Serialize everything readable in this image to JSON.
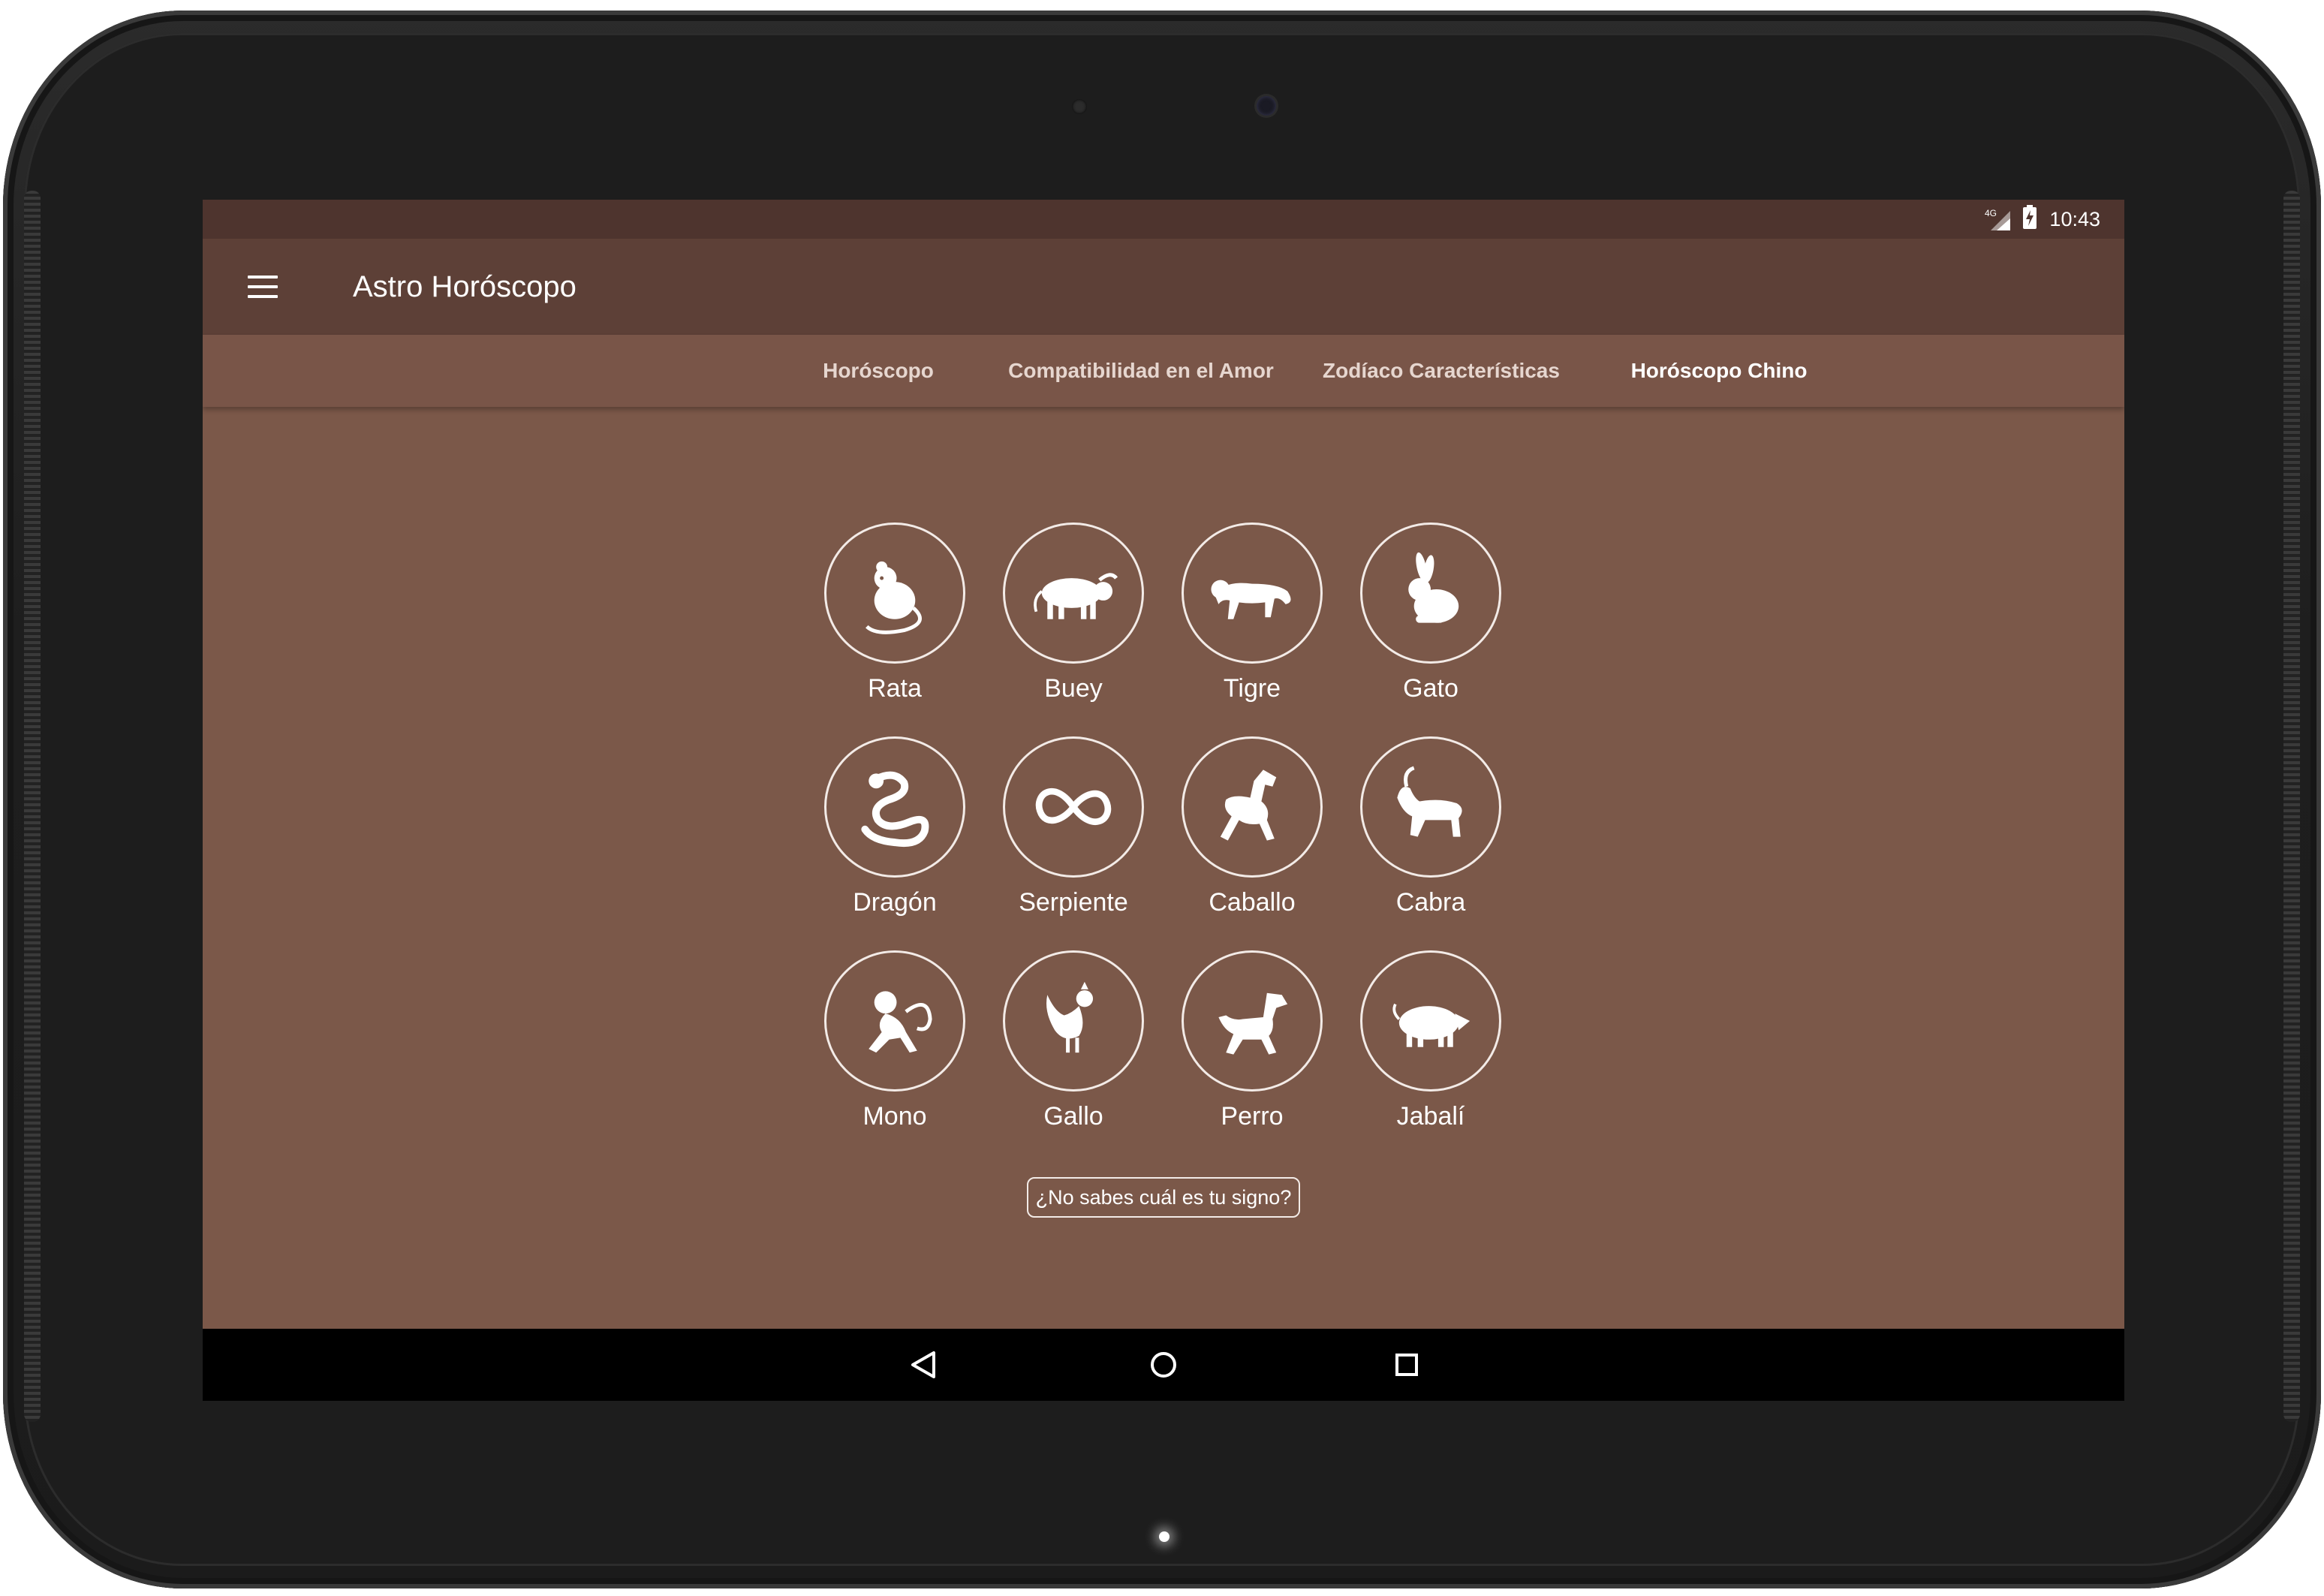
{
  "status_bar": {
    "network": "4G",
    "time": "10:43"
  },
  "app_bar": {
    "title": "Astro Horóscopo",
    "menu_icon": "hamburger-menu-icon"
  },
  "tabs": [
    {
      "label": "Horóscopo",
      "active": false
    },
    {
      "label": "Compatibilidad en el Amor",
      "active": false
    },
    {
      "label": "Zodíaco Características",
      "active": false
    },
    {
      "label": "Horóscopo Chino",
      "active": true
    }
  ],
  "signs": [
    {
      "name": "Rata",
      "icon": "rat-icon"
    },
    {
      "name": "Buey",
      "icon": "ox-icon"
    },
    {
      "name": "Tigre",
      "icon": "tiger-icon"
    },
    {
      "name": "Gato",
      "icon": "rabbit-icon"
    },
    {
      "name": "Dragón",
      "icon": "dragon-icon"
    },
    {
      "name": "Serpiente",
      "icon": "snake-icon"
    },
    {
      "name": "Caballo",
      "icon": "horse-icon"
    },
    {
      "name": "Cabra",
      "icon": "goat-icon"
    },
    {
      "name": "Mono",
      "icon": "monkey-icon"
    },
    {
      "name": "Gallo",
      "icon": "rooster-icon"
    },
    {
      "name": "Perro",
      "icon": "dog-icon"
    },
    {
      "name": "Jabalí",
      "icon": "boar-icon"
    }
  ],
  "help_button": {
    "label": "¿No sabes cuál es tu signo?"
  },
  "nav_bar": {
    "back_icon": "back-triangle-icon",
    "home_icon": "home-circle-icon",
    "recents_icon": "recents-square-icon"
  },
  "colors": {
    "status_bar": "#4e342e",
    "app_bar": "#5d4037",
    "tab_bar": "#795548",
    "content_bg": "#7b5849",
    "nav_bar": "#000000"
  }
}
